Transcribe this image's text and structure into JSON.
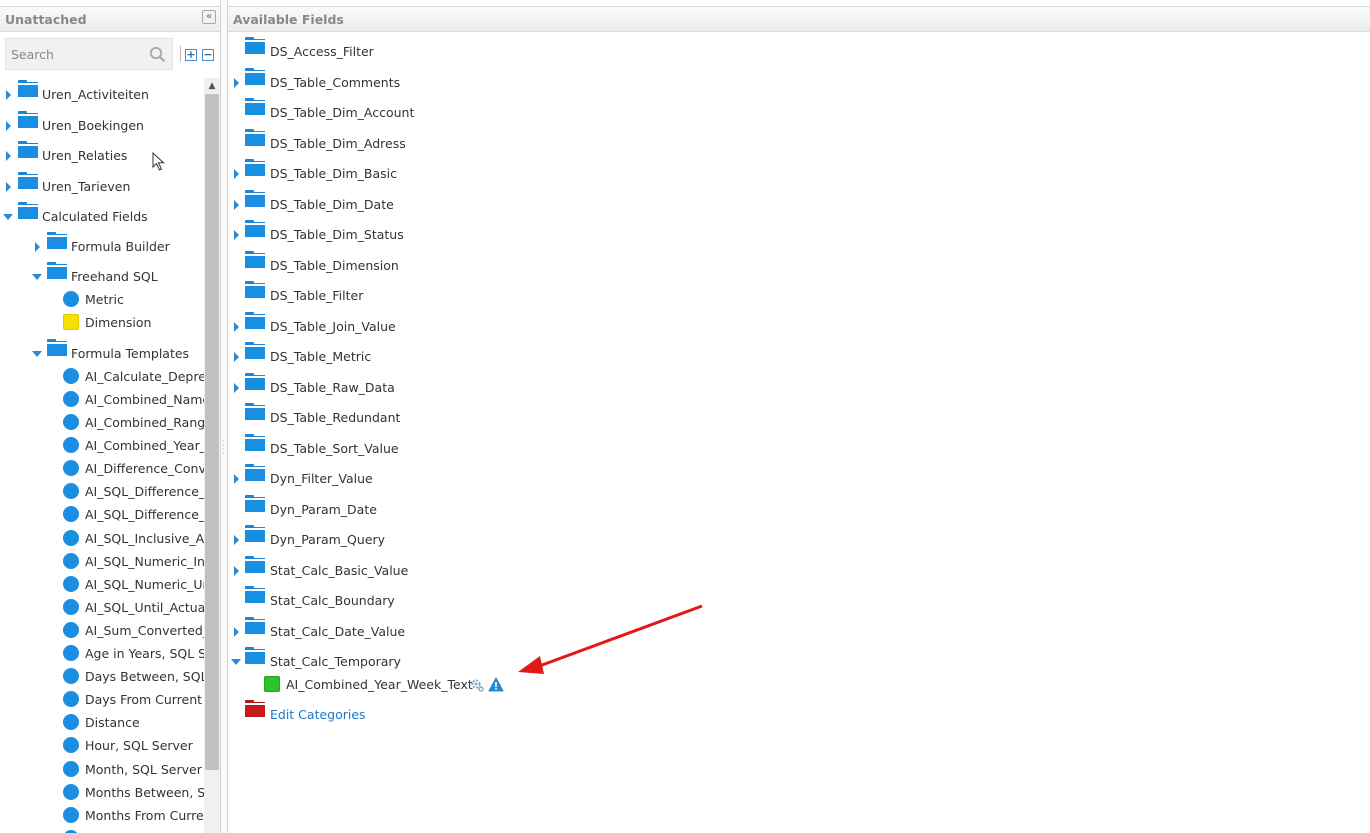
{
  "left_panel": {
    "title": "Unattached",
    "collapse_glyph": "«",
    "search_placeholder": "Search",
    "expand_all_glyph": "+",
    "collapse_all_glyph": "−",
    "tree": [
      {
        "label": "Uren_Activiteiten"
      },
      {
        "label": "Uren_Boekingen"
      },
      {
        "label": "Uren_Relaties"
      },
      {
        "label": "Uren_Tarieven"
      },
      {
        "label": "Calculated Fields"
      },
      {
        "label": "Formula Builder"
      },
      {
        "label": "Freehand SQL"
      },
      {
        "label": "Metric"
      },
      {
        "label": "Dimension"
      },
      {
        "label": "Formula Templates"
      },
      {
        "label": "AI_Calculate_Depreciation"
      },
      {
        "label": "AI_Combined_Name"
      },
      {
        "label": "AI_Combined_Range"
      },
      {
        "label": "AI_Combined_Year_"
      },
      {
        "label": "AI_Difference_Conversion"
      },
      {
        "label": "AI_SQL_Difference_I"
      },
      {
        "label": "AI_SQL_Difference_U"
      },
      {
        "label": "AI_SQL_Inclusive_Ac"
      },
      {
        "label": "AI_SQL_Numeric_In"
      },
      {
        "label": "AI_SQL_Numeric_Ur"
      },
      {
        "label": "AI_SQL_Until_Actual"
      },
      {
        "label": "AI_Sum_Converted_"
      },
      {
        "label": "Age in Years, SQL Server"
      },
      {
        "label": "Days Between, SQL Server"
      },
      {
        "label": "Days From Current Date"
      },
      {
        "label": "Distance"
      },
      {
        "label": "Hour, SQL Server"
      },
      {
        "label": "Month, SQL Server"
      },
      {
        "label": "Months Between, SQL"
      },
      {
        "label": "Months From Current"
      }
    ]
  },
  "right_panel": {
    "title": "Available Fields",
    "tree": [
      {
        "label": "DS_Access_Filter"
      },
      {
        "label": "DS_Table_Comments"
      },
      {
        "label": "DS_Table_Dim_Account"
      },
      {
        "label": "DS_Table_Dim_Adress"
      },
      {
        "label": "DS_Table_Dim_Basic"
      },
      {
        "label": "DS_Table_Dim_Date"
      },
      {
        "label": "DS_Table_Dim_Status"
      },
      {
        "label": "DS_Table_Dimension"
      },
      {
        "label": "DS_Table_Filter"
      },
      {
        "label": "DS_Table_Join_Value"
      },
      {
        "label": "DS_Table_Metric"
      },
      {
        "label": "DS_Table_Raw_Data"
      },
      {
        "label": "DS_Table_Redundant"
      },
      {
        "label": "DS_Table_Sort_Value"
      },
      {
        "label": "Dyn_Filter_Value"
      },
      {
        "label": "Dyn_Param_Date"
      },
      {
        "label": "Dyn_Param_Query"
      },
      {
        "label": "Stat_Calc_Basic_Value"
      },
      {
        "label": "Stat_Calc_Boundary"
      },
      {
        "label": "Stat_Calc_Date_Value"
      },
      {
        "label": "Stat_Calc_Temporary"
      },
      {
        "label": "AI_Combined_Year_Week_Text"
      },
      {
        "label": "Edit Categories"
      }
    ]
  },
  "colors": {
    "folder_blue": "#1a8ee0",
    "metric_blue": "#1a8ee0",
    "dimension_yellow": "#f5e000",
    "field_green": "#2dc22d",
    "edit_categories_red": "#c41c1c",
    "link_blue": "#1f78c1",
    "annotation_arrow_red": "#e01818"
  },
  "icons": [
    "search-icon",
    "collapse-panel-icon",
    "expand-all-icon",
    "collapse-all-icon",
    "folder-icon",
    "metric-icon",
    "dimension-icon",
    "gear-icon",
    "warning-icon",
    "mouse-cursor-icon",
    "annotation-arrow"
  ]
}
